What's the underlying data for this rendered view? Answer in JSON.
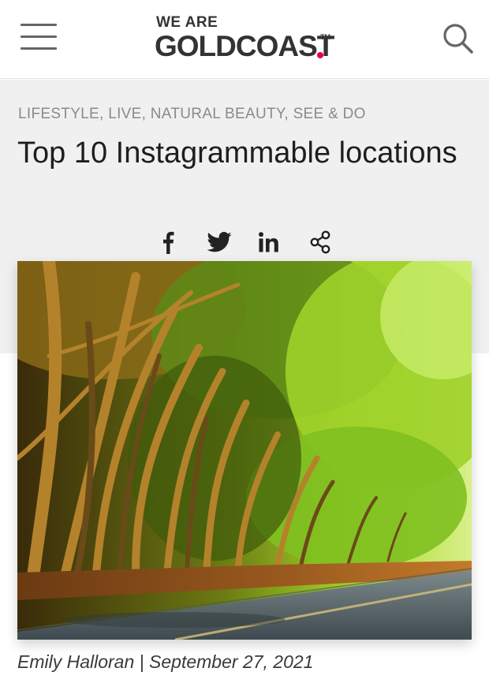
{
  "header": {
    "logo_top": "WE ARE",
    "logo_main": "GOLDCOAST",
    "logo_tm": "TM",
    "menu_icon": "hamburger-menu-icon",
    "search_icon": "search-icon",
    "accent_color": "#e6004c"
  },
  "article": {
    "categories": [
      {
        "label": "LIFESTYLE",
        "sep": ", "
      },
      {
        "label": "LIVE",
        "sep": ", "
      },
      {
        "label": "NATURAL BEAUTY",
        "sep": ", "
      },
      {
        "label": "SEE & DO",
        "sep": ""
      }
    ],
    "title": "Top 10 Instagrammable locations",
    "share_icons": [
      "facebook-icon",
      "twitter-icon",
      "linkedin-icon",
      "share-icon"
    ],
    "image_icon": "tree-lined-road-photo",
    "author": "Emily Halloran",
    "byline_sep": " | ",
    "date": "September 27, 2021"
  }
}
